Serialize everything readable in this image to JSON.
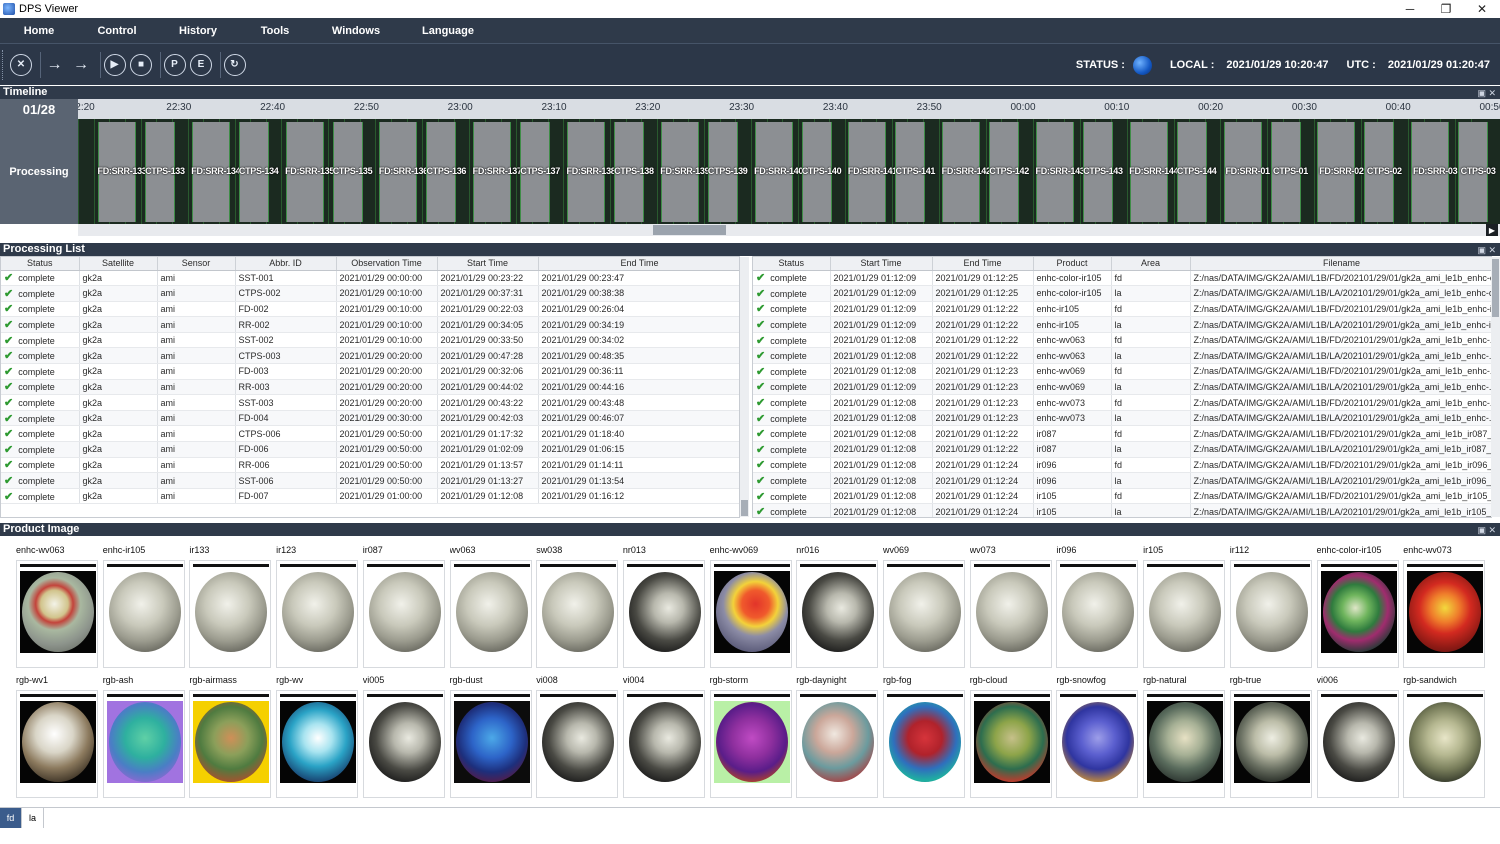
{
  "window": {
    "title": "DPS Viewer",
    "min": "─",
    "max": "❐",
    "close": "✕"
  },
  "menu": [
    "Home",
    "Control",
    "History",
    "Tools",
    "Windows",
    "Language"
  ],
  "toolbar": {
    "buttons": [
      {
        "name": "stop-all-icon",
        "glyph": "✕"
      },
      {
        "name": "login-icon",
        "glyph": "→"
      },
      {
        "name": "logout-icon",
        "glyph": "→"
      },
      {
        "name": "play-icon",
        "glyph": "▶"
      },
      {
        "name": "stop-icon",
        "glyph": "■"
      },
      {
        "name": "zoom-p-icon",
        "glyph": "P"
      },
      {
        "name": "zoom-e-icon",
        "glyph": "E"
      },
      {
        "name": "refresh-icon",
        "glyph": "↻"
      }
    ],
    "status_label": "STATUS :",
    "local_label": "LOCAL :",
    "local_time": "2021/01/29 10:20:47",
    "utc_label": "UTC :",
    "utc_time": "2021/01/29 01:20:47"
  },
  "timeline": {
    "header": "Timeline",
    "date": "01/28",
    "row_label": "Processing",
    "ticks": [
      "2:20",
      "22:30",
      "22:40",
      "22:50",
      "23:00",
      "23:10",
      "23:20",
      "23:30",
      "23:40",
      "23:50",
      "00:00",
      "00:10",
      "00:20",
      "00:30",
      "00:40",
      "00:50"
    ],
    "jobs": [
      "FD:SRR-133",
      "CTPS-133",
      "FD:SRR-134",
      "CTPS-134",
      "FD:SRR-135",
      "CTPS-135",
      "FD:SRR-136",
      "CTPS-136",
      "FD:SRR-137",
      "CTPS-137",
      "FD:SRR-138",
      "CTPS-138",
      "FD:SRR-139",
      "CTPS-139",
      "FD:SRR-140",
      "CTPS-140",
      "FD:SRR-141",
      "CTPS-141",
      "FD:SRR-142",
      "CTPS-142",
      "FD:SRR-143",
      "CTPS-143",
      "FD:SRR-144",
      "CTPS-144",
      "FD:SRR-01",
      "CTPS-01",
      "FD:SRR-02",
      "CTPS-02",
      "FD:SRR-03",
      "CTPS-03"
    ]
  },
  "processing_list": {
    "header": "Processing List",
    "left_columns": [
      "Status",
      "Satellite",
      "Sensor",
      "Abbr. ID",
      "Observation Time",
      "Start Time",
      "End Time"
    ],
    "left_rows": [
      [
        "complete",
        "gk2a",
        "ami",
        "SST-001",
        "2021/01/29 00:00:00",
        "2021/01/29 00:23:22",
        "2021/01/29 00:23:47"
      ],
      [
        "complete",
        "gk2a",
        "ami",
        "CTPS-002",
        "2021/01/29 00:10:00",
        "2021/01/29 00:37:31",
        "2021/01/29 00:38:38"
      ],
      [
        "complete",
        "gk2a",
        "ami",
        "FD-002",
        "2021/01/29 00:10:00",
        "2021/01/29 00:22:03",
        "2021/01/29 00:26:04"
      ],
      [
        "complete",
        "gk2a",
        "ami",
        "RR-002",
        "2021/01/29 00:10:00",
        "2021/01/29 00:34:05",
        "2021/01/29 00:34:19"
      ],
      [
        "complete",
        "gk2a",
        "ami",
        "SST-002",
        "2021/01/29 00:10:00",
        "2021/01/29 00:33:50",
        "2021/01/29 00:34:02"
      ],
      [
        "complete",
        "gk2a",
        "ami",
        "CTPS-003",
        "2021/01/29 00:20:00",
        "2021/01/29 00:47:28",
        "2021/01/29 00:48:35"
      ],
      [
        "complete",
        "gk2a",
        "ami",
        "FD-003",
        "2021/01/29 00:20:00",
        "2021/01/29 00:32:06",
        "2021/01/29 00:36:11"
      ],
      [
        "complete",
        "gk2a",
        "ami",
        "RR-003",
        "2021/01/29 00:20:00",
        "2021/01/29 00:44:02",
        "2021/01/29 00:44:16"
      ],
      [
        "complete",
        "gk2a",
        "ami",
        "SST-003",
        "2021/01/29 00:20:00",
        "2021/01/29 00:43:22",
        "2021/01/29 00:43:48"
      ],
      [
        "complete",
        "gk2a",
        "ami",
        "FD-004",
        "2021/01/29 00:30:00",
        "2021/01/29 00:42:03",
        "2021/01/29 00:46:07"
      ],
      [
        "complete",
        "gk2a",
        "ami",
        "CTPS-006",
        "2021/01/29 00:50:00",
        "2021/01/29 01:17:32",
        "2021/01/29 01:18:40"
      ],
      [
        "complete",
        "gk2a",
        "ami",
        "FD-006",
        "2021/01/29 00:50:00",
        "2021/01/29 01:02:09",
        "2021/01/29 01:06:15"
      ],
      [
        "complete",
        "gk2a",
        "ami",
        "RR-006",
        "2021/01/29 00:50:00",
        "2021/01/29 01:13:57",
        "2021/01/29 01:14:11"
      ],
      [
        "complete",
        "gk2a",
        "ami",
        "SST-006",
        "2021/01/29 00:50:00",
        "2021/01/29 01:13:27",
        "2021/01/29 01:13:54"
      ],
      [
        "complete",
        "gk2a",
        "ami",
        "FD-007",
        "2021/01/29 01:00:00",
        "2021/01/29 01:12:08",
        "2021/01/29 01:16:12"
      ]
    ],
    "right_columns": [
      "Status",
      "Start Time",
      "End Time",
      "Product",
      "Area",
      "Filename"
    ],
    "right_rows": [
      [
        "complete",
        "2021/01/29 01:12:09",
        "2021/01/29 01:12:25",
        "enhc-color-ir105",
        "fd",
        "Z:/nas/DATA/IMG/GK2A/AMI/L1B/FD/202101/29/01/gk2a_ami_le1b_enhc-c..."
      ],
      [
        "complete",
        "2021/01/29 01:12:09",
        "2021/01/29 01:12:25",
        "enhc-color-ir105",
        "la",
        "Z:/nas/DATA/IMG/GK2A/AMI/L1B/LA/202101/29/01/gk2a_ami_le1b_enhc-c..."
      ],
      [
        "complete",
        "2021/01/29 01:12:09",
        "2021/01/29 01:12:22",
        "enhc-ir105",
        "fd",
        "Z:/nas/DATA/IMG/GK2A/AMI/L1B/FD/202101/29/01/gk2a_ami_le1b_enhc-i..."
      ],
      [
        "complete",
        "2021/01/29 01:12:09",
        "2021/01/29 01:12:22",
        "enhc-ir105",
        "la",
        "Z:/nas/DATA/IMG/GK2A/AMI/L1B/LA/202101/29/01/gk2a_ami_le1b_enhc-ir..."
      ],
      [
        "complete",
        "2021/01/29 01:12:08",
        "2021/01/29 01:12:22",
        "enhc-wv063",
        "fd",
        "Z:/nas/DATA/IMG/GK2A/AMI/L1B/FD/202101/29/01/gk2a_ami_le1b_enhc-..."
      ],
      [
        "complete",
        "2021/01/29 01:12:08",
        "2021/01/29 01:12:22",
        "enhc-wv063",
        "la",
        "Z:/nas/DATA/IMG/GK2A/AMI/L1B/LA/202101/29/01/gk2a_ami_le1b_enhc-..."
      ],
      [
        "complete",
        "2021/01/29 01:12:08",
        "2021/01/29 01:12:23",
        "enhc-wv069",
        "fd",
        "Z:/nas/DATA/IMG/GK2A/AMI/L1B/FD/202101/29/01/gk2a_ami_le1b_enhc-..."
      ],
      [
        "complete",
        "2021/01/29 01:12:09",
        "2021/01/29 01:12:23",
        "enhc-wv069",
        "la",
        "Z:/nas/DATA/IMG/GK2A/AMI/L1B/LA/202101/29/01/gk2a_ami_le1b_enhc-..."
      ],
      [
        "complete",
        "2021/01/29 01:12:08",
        "2021/01/29 01:12:23",
        "enhc-wv073",
        "fd",
        "Z:/nas/DATA/IMG/GK2A/AMI/L1B/FD/202101/29/01/gk2a_ami_le1b_enhc-..."
      ],
      [
        "complete",
        "2021/01/29 01:12:08",
        "2021/01/29 01:12:23",
        "enhc-wv073",
        "la",
        "Z:/nas/DATA/IMG/GK2A/AMI/L1B/LA/202101/29/01/gk2a_ami_le1b_enhc-..."
      ],
      [
        "complete",
        "2021/01/29 01:12:08",
        "2021/01/29 01:12:22",
        "ir087",
        "fd",
        "Z:/nas/DATA/IMG/GK2A/AMI/L1B/FD/202101/29/01/gk2a_ami_le1b_ir087_f..."
      ],
      [
        "complete",
        "2021/01/29 01:12:08",
        "2021/01/29 01:12:22",
        "ir087",
        "la",
        "Z:/nas/DATA/IMG/GK2A/AMI/L1B/LA/202101/29/01/gk2a_ami_le1b_ir087_l..."
      ],
      [
        "complete",
        "2021/01/29 01:12:08",
        "2021/01/29 01:12:24",
        "ir096",
        "fd",
        "Z:/nas/DATA/IMG/GK2A/AMI/L1B/FD/202101/29/01/gk2a_ami_le1b_ir096_f..."
      ],
      [
        "complete",
        "2021/01/29 01:12:08",
        "2021/01/29 01:12:24",
        "ir096",
        "la",
        "Z:/nas/DATA/IMG/GK2A/AMI/L1B/LA/202101/29/01/gk2a_ami_le1b_ir096_l..."
      ],
      [
        "complete",
        "2021/01/29 01:12:08",
        "2021/01/29 01:12:24",
        "ir105",
        "fd",
        "Z:/nas/DATA/IMG/GK2A/AMI/L1B/FD/202101/29/01/gk2a_ami_le1b_ir105_f..."
      ],
      [
        "complete",
        "2021/01/29 01:12:08",
        "2021/01/29 01:12:24",
        "ir105",
        "la",
        "Z:/nas/DATA/IMG/GK2A/AMI/L1B/LA/202101/29/01/gk2a_ami_le1b_ir105_l..."
      ]
    ]
  },
  "product_image": {
    "header": "Product Image",
    "row1": [
      {
        "name": "enhc-wv063",
        "style": "wv063"
      },
      {
        "name": "enhc-ir105",
        "style": "ir"
      },
      {
        "name": "ir133",
        "style": "ir"
      },
      {
        "name": "ir123",
        "style": "ir"
      },
      {
        "name": "ir087",
        "style": "ir"
      },
      {
        "name": "wv063",
        "style": "ir"
      },
      {
        "name": "sw038",
        "style": "ir"
      },
      {
        "name": "nr013",
        "style": "vis"
      },
      {
        "name": "enhc-wv069",
        "style": "wv069"
      },
      {
        "name": "nr016",
        "style": "vis"
      },
      {
        "name": "wv069",
        "style": "ir"
      },
      {
        "name": "wv073",
        "style": "ir"
      },
      {
        "name": "ir096",
        "style": "ir"
      },
      {
        "name": "ir105",
        "style": "ir"
      },
      {
        "name": "ir112",
        "style": "ir"
      },
      {
        "name": "enhc-color-ir105",
        "style": "color"
      },
      {
        "name": "enhc-wv073",
        "style": "wv073"
      }
    ],
    "row2": [
      {
        "name": "rgb-wv1",
        "style": "wv1"
      },
      {
        "name": "rgb-ash",
        "style": "ash"
      },
      {
        "name": "rgb-airmass",
        "style": "airmass"
      },
      {
        "name": "rgb-wv",
        "style": "rgbwv"
      },
      {
        "name": "vi005",
        "style": "vis"
      },
      {
        "name": "rgb-dust",
        "style": "dust"
      },
      {
        "name": "vi008",
        "style": "vis"
      },
      {
        "name": "vi004",
        "style": "vis"
      },
      {
        "name": "rgb-storm",
        "style": "storm"
      },
      {
        "name": "rgb-daynight",
        "style": "daynight"
      },
      {
        "name": "rgb-fog",
        "style": "fog"
      },
      {
        "name": "rgb-cloud",
        "style": "cloud"
      },
      {
        "name": "rgb-snowfog",
        "style": "snowfog"
      },
      {
        "name": "rgb-natural",
        "style": "natural"
      },
      {
        "name": "rgb-true",
        "style": "true"
      },
      {
        "name": "vi006",
        "style": "vis"
      },
      {
        "name": "rgb-sandwich",
        "style": "sandwich"
      }
    ]
  },
  "area_tabs": [
    {
      "label": "fd",
      "active": true
    },
    {
      "label": "la",
      "active": false
    }
  ]
}
